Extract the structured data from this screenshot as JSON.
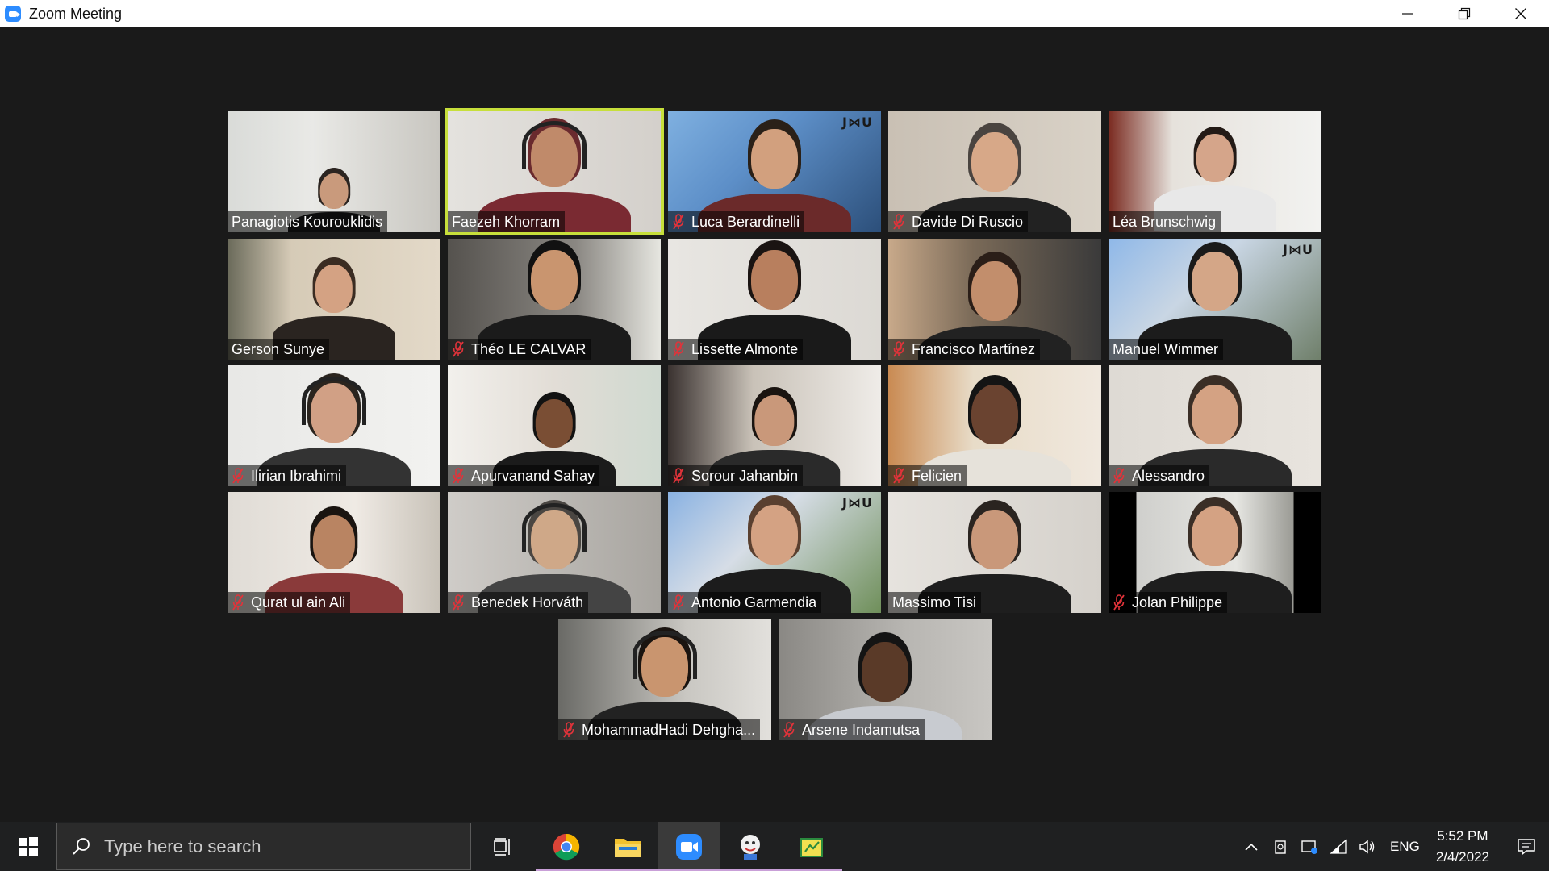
{
  "window": {
    "title": "Zoom Meeting"
  },
  "participants": [
    {
      "name": "Panagiotis Kourouklidis",
      "muted": false,
      "active": false
    },
    {
      "name": "Faezeh Khorram",
      "muted": false,
      "active": true
    },
    {
      "name": "Luca Berardinelli",
      "muted": true,
      "active": false
    },
    {
      "name": "Davide Di Ruscio",
      "muted": true,
      "active": false
    },
    {
      "name": "Léa Brunschwig",
      "muted": false,
      "active": false
    },
    {
      "name": "Gerson Sunye",
      "muted": false,
      "active": false
    },
    {
      "name": "Théo LE CALVAR",
      "muted": true,
      "active": false
    },
    {
      "name": "Lissette Almonte",
      "muted": true,
      "active": false
    },
    {
      "name": "Francisco Martínez",
      "muted": true,
      "active": false
    },
    {
      "name": "Manuel Wimmer",
      "muted": false,
      "active": false
    },
    {
      "name": "Ilirian Ibrahimi",
      "muted": true,
      "active": false
    },
    {
      "name": "Apurvanand Sahay",
      "muted": true,
      "active": false
    },
    {
      "name": "Sorour Jahanbin",
      "muted": true,
      "active": false
    },
    {
      "name": "Felicien",
      "muted": true,
      "active": false
    },
    {
      "name": "Alessandro",
      "muted": true,
      "active": false
    },
    {
      "name": "Qurat ul ain Ali",
      "muted": true,
      "active": false
    },
    {
      "name": "Benedek Horváth",
      "muted": true,
      "active": false
    },
    {
      "name": "Antonio Garmendia",
      "muted": true,
      "active": false
    },
    {
      "name": "Massimo Tisi",
      "muted": false,
      "active": false
    },
    {
      "name": "Jolan Philippe",
      "muted": true,
      "active": false
    },
    {
      "name": "MohammadHadi Dehgha...",
      "muted": true,
      "active": false
    },
    {
      "name": "Arsene Indamutsa",
      "muted": true,
      "active": false
    }
  ],
  "backgrounds": {
    "jku_logo": "J⋈U"
  },
  "taskbar": {
    "search_placeholder": "Type here to search",
    "apps": [
      "task-view",
      "chrome",
      "file-explorer",
      "zoom",
      "user-app",
      "sheets-app"
    ],
    "language": "ENG",
    "time": "5:52 PM",
    "date": "2/4/2022"
  },
  "colors": {
    "active_speaker": "#c7df3b",
    "mute_red": "#e0333a",
    "zoom_blue": "#2D8CFF",
    "taskbar_bg": "#1f2021"
  }
}
